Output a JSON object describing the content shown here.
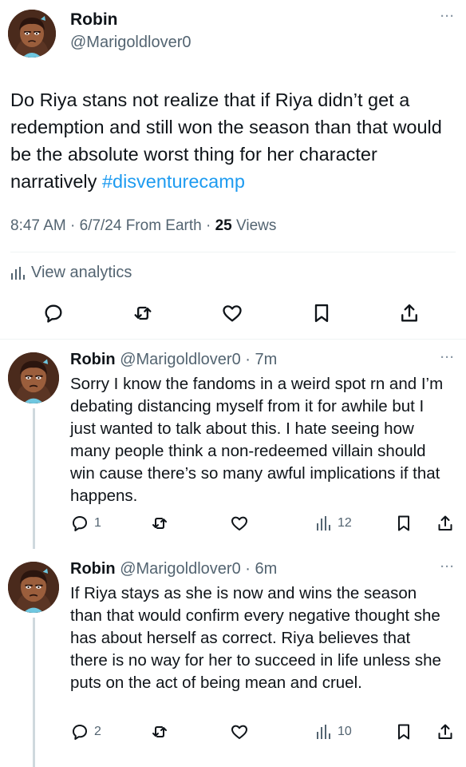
{
  "main_tweet": {
    "name": "Robin",
    "handle": "@Marigoldlover0",
    "more": "···",
    "text": "Do Riya stans not realize that if Riya didn’t get a redemption and still won the season than that would be the absolute worst thing for her character narratively ",
    "hashtag": "#disventurecamp",
    "time": "8:47 AM · 6/7/24 From Earth · ",
    "views_count": "25",
    "views_label": " Views",
    "analytics_label": "View analytics",
    "icons": [
      "reply-icon",
      "retweet-icon",
      "like-icon",
      "bookmark-icon",
      "share-icon"
    ]
  },
  "replies": [
    {
      "name": "Robin",
      "meta": " @Marigoldlover0 · 7m",
      "more": "···",
      "text": "Sorry I know the fandoms in a weird spot rn and I’m debating distancing myself from it for awhile but I just wanted to talk about this. I hate seeing how many people think a non-redeemed villain should win cause there’s so many awful implications if that happens.",
      "reply_count": "1",
      "views_count": "12"
    },
    {
      "name": "Robin",
      "meta": " @Marigoldlover0 · 6m",
      "more": "···",
      "text": "If Riya stays as she is now and wins the season than that would confirm every negative thought she has about herself as correct. Riya believes that there is no way for her to succeed in life unless she puts on the act of being mean and cruel.",
      "reply_count": "2",
      "views_count": "10"
    }
  ],
  "colors": {
    "link": "#1d9bf0",
    "secondary_text": "#536471",
    "primary_text": "#0f1419",
    "divider": "#eff3f4"
  }
}
